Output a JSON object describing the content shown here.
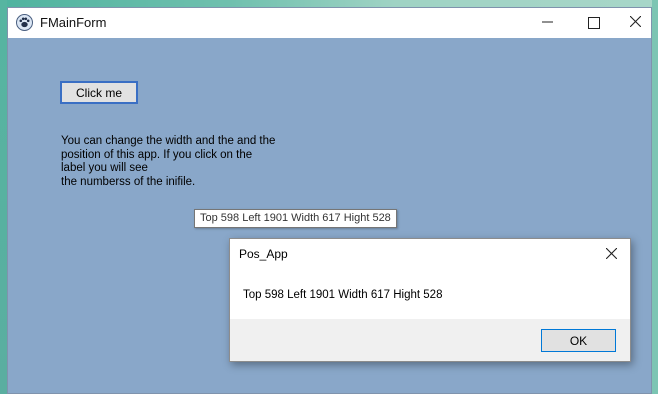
{
  "main_window": {
    "title": "FMainForm",
    "icon": "paw-icon",
    "controls": {
      "minimize": "minimize-icon",
      "maximize": "maximize-icon",
      "close": "close-icon"
    }
  },
  "content": {
    "button_label": "Click me",
    "info_lines": [
      "You can change the width and the and the",
      "position of this app. If you click on the",
      "label you will see",
      "the numberss of the inifile."
    ],
    "tooltip": "Top 598 Left 1901 Width 617 Hight 528"
  },
  "dialog": {
    "title": "Pos_App",
    "message": "Top 598 Left 1901 Width 617 Hight 528",
    "ok_label": "OK"
  },
  "colors": {
    "form_background": "#89a7c9",
    "desktop": "#5cb6a4",
    "accent": "#0078d7"
  }
}
